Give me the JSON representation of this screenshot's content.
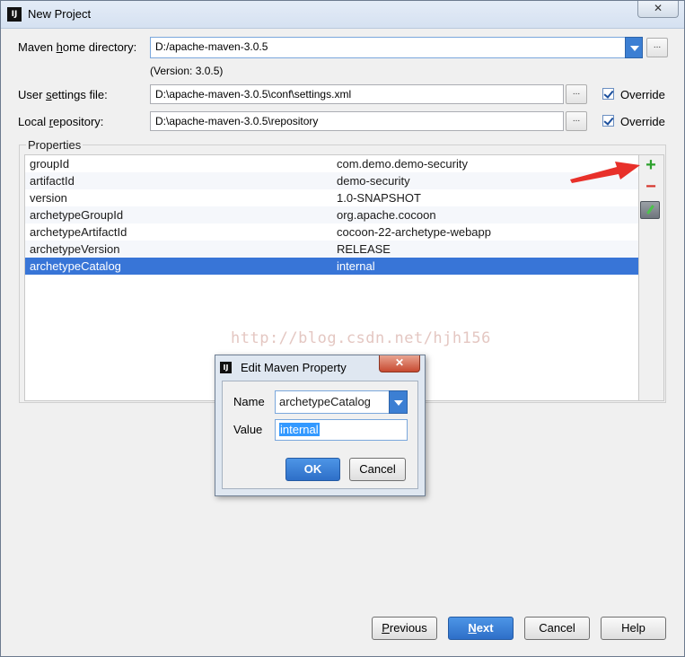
{
  "window": {
    "title": "New Project",
    "icon": "intellij-icon",
    "close_label": "✕"
  },
  "form": {
    "maven_home": {
      "label_pre": "Maven ",
      "label_u": "h",
      "label_post": "ome directory:",
      "value": "D:/apache-maven-3.0.5",
      "version_note": "(Version: 3.0.5)"
    },
    "user_settings": {
      "label_pre": "User ",
      "label_u": "s",
      "label_post": "ettings file:",
      "value": "D:\\apache-maven-3.0.5\\conf\\settings.xml",
      "override_label": "Override",
      "override_checked": true
    },
    "local_repo": {
      "label_pre": "Local ",
      "label_u": "r",
      "label_post": "epository:",
      "value": "D:\\apache-maven-3.0.5\\repository",
      "override_label": "Override",
      "override_checked": true
    },
    "browse_label": "..."
  },
  "properties": {
    "title": "Properties",
    "rows": [
      {
        "key": "groupId",
        "value": "com.demo.demo-security"
      },
      {
        "key": "artifactId",
        "value": "demo-security"
      },
      {
        "key": "version",
        "value": "1.0-SNAPSHOT"
      },
      {
        "key": "archetypeGroupId",
        "value": "org.apache.cocoon"
      },
      {
        "key": "archetypeArtifactId",
        "value": "cocoon-22-archetype-webapp"
      },
      {
        "key": "archetypeVersion",
        "value": "RELEASE"
      },
      {
        "key": "archetypeCatalog",
        "value": "internal"
      }
    ],
    "selected_index": 6,
    "add_label": "+",
    "remove_label": "−"
  },
  "watermark": "http://blog.csdn.net/hjh156",
  "dialog": {
    "title": "Edit Maven Property",
    "close_label": "✕",
    "name_label": "Name",
    "name_value": "archetypeCatalog",
    "value_label": "Value",
    "value_value": "internal",
    "ok_label": "OK",
    "cancel_label": "Cancel"
  },
  "footer": {
    "previous_u": "P",
    "previous_rest": "revious",
    "next_u": "N",
    "next_rest": "ext",
    "cancel_label": "Cancel",
    "help_label": "Help"
  },
  "colors": {
    "selection": "#3875d7",
    "accent": "#3c7fd3",
    "add": "#2da12d",
    "remove": "#d6352c",
    "annotation_arrow": "#e8302a"
  }
}
